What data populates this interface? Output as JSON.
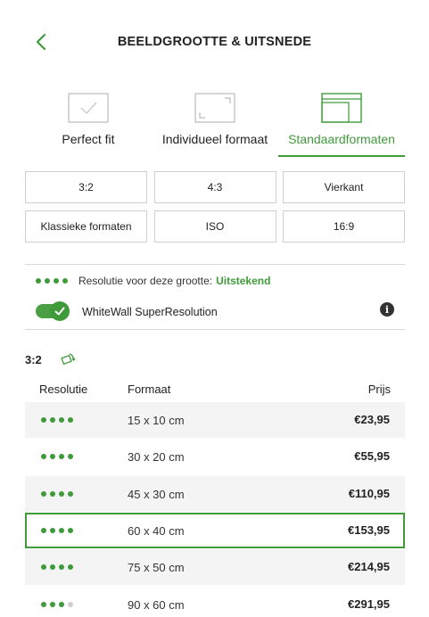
{
  "header": {
    "title": "BEELDGROOTTE & UITSNEDE",
    "back_icon": "chevron-left-icon"
  },
  "mode_tabs": [
    {
      "label": "Perfect fit",
      "icon": "checkmark-frame-icon",
      "active": false
    },
    {
      "label": "Individueel formaat",
      "icon": "crop-corners-icon",
      "active": false
    },
    {
      "label": "Standaardformaten",
      "icon": "stacked-frames-icon",
      "active": true
    }
  ],
  "format_buttons": [
    "3:2",
    "4:3",
    "Vierkant",
    "Klassieke formaten",
    "ISO",
    "16:9"
  ],
  "resolution": {
    "text": "Resolutie voor deze grootte:",
    "value": "Uitstekend",
    "level": 4
  },
  "superresolution": {
    "label": "WhiteWall SuperResolution",
    "enabled": true
  },
  "ratio": {
    "label": "3:2",
    "rotate_icon": "rotate-icon"
  },
  "table": {
    "headers": {
      "resolution": "Resolutie",
      "format": "Formaat",
      "price": "Prijs"
    },
    "rows": [
      {
        "dots": 4,
        "format": "15 x 10 cm",
        "price": "€23,95",
        "selected": false
      },
      {
        "dots": 4,
        "format": "30 x 20 cm",
        "price": "€55,95",
        "selected": false
      },
      {
        "dots": 4,
        "format": "45 x 30 cm",
        "price": "€110,95",
        "selected": false
      },
      {
        "dots": 4,
        "format": "60 x 40 cm",
        "price": "€153,95",
        "selected": true
      },
      {
        "dots": 4,
        "format": "75 x 50 cm",
        "price": "€214,95",
        "selected": false
      },
      {
        "dots": 3,
        "format": "90 x 60 cm",
        "price": "€291,95",
        "selected": false
      }
    ]
  },
  "colors": {
    "accent": "#3f9a3a",
    "border": "#cfcfcf",
    "row_shade": "#f4f4f4"
  }
}
